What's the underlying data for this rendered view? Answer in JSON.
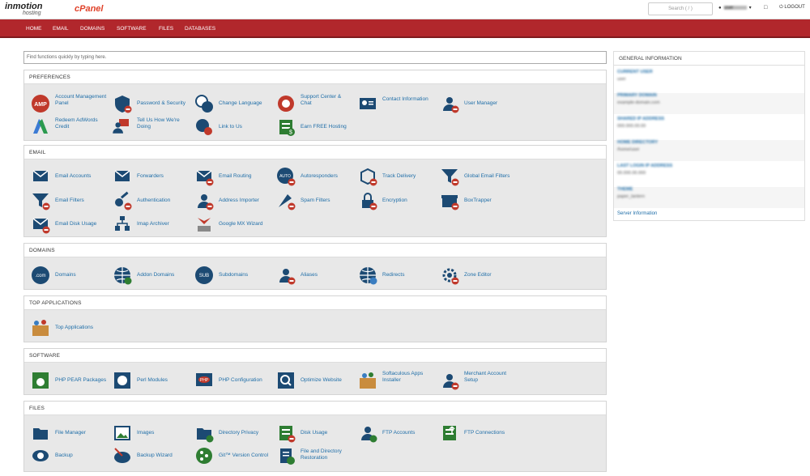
{
  "brand": {
    "imh_top": "inmotion",
    "imh_sub": "hosting",
    "cpanel": "cPanel"
  },
  "header": {
    "search_placeholder": "Search ( / )",
    "user": "user",
    "logout": "LOGOUT",
    "caret": "▾",
    "window_icon": "□"
  },
  "nav": [
    "HOME",
    "EMAIL",
    "DOMAINS",
    "SOFTWARE",
    "FILES",
    "DATABASES"
  ],
  "find_placeholder": "Find functions quickly by typing here.",
  "sections": {
    "preferences": {
      "title": "PREFERENCES",
      "items": [
        "Account Management Panel",
        "Password & Security",
        "Change Language",
        "Support Center & Chat",
        "Contact Information",
        "User Manager",
        "Redeem AdWords Credit",
        "Tell Us How We're Doing",
        "Link to Us",
        "Earn FREE Hosting"
      ]
    },
    "email": {
      "title": "EMAIL",
      "items": [
        "Email Accounts",
        "Forwarders",
        "Email Routing",
        "Autoresponders",
        "Track Delivery",
        "Global Email Filters",
        "Email Filters",
        "Authentication",
        "Address Importer",
        "Spam Filters",
        "Encryption",
        "BoxTrapper",
        "Email Disk Usage",
        "Imap Archiver",
        "Google MX Wizard"
      ]
    },
    "domains": {
      "title": "DOMAINS",
      "items": [
        "Domains",
        "Addon Domains",
        "Subdomains",
        "Aliases",
        "Redirects",
        "Zone Editor"
      ]
    },
    "topapps": {
      "title": "TOP APPLICATIONS",
      "items": [
        "Top Applications"
      ]
    },
    "software": {
      "title": "SOFTWARE",
      "items": [
        "PHP PEAR Packages",
        "Perl Modules",
        "PHP Configuration",
        "Optimize Website",
        "Softaculous Apps Installer",
        "Merchant Account Setup"
      ]
    },
    "files": {
      "title": "FILES",
      "items": [
        "File Manager",
        "Images",
        "Directory Privacy",
        "Disk Usage",
        "FTP Accounts",
        "FTP Connections",
        "Backup",
        "Backup Wizard",
        "Git™ Version Control",
        "File and Directory Restoration"
      ]
    }
  },
  "general": {
    "title": "GENERAL INFORMATION",
    "rows": [
      {
        "k": "CURRENT USER",
        "v": "user"
      },
      {
        "k": "PRIMARY DOMAIN",
        "v": "example-domain.com"
      },
      {
        "k": "SHARED IP ADDRESS",
        "v": "000.000.00.00"
      },
      {
        "k": "HOME DIRECTORY",
        "v": "/home/user"
      },
      {
        "k": "LAST LOGIN IP ADDRESS",
        "v": "00.000.00.000"
      },
      {
        "k": "THEME",
        "v": "paper_lantern"
      }
    ],
    "server_link": "Server Information"
  }
}
